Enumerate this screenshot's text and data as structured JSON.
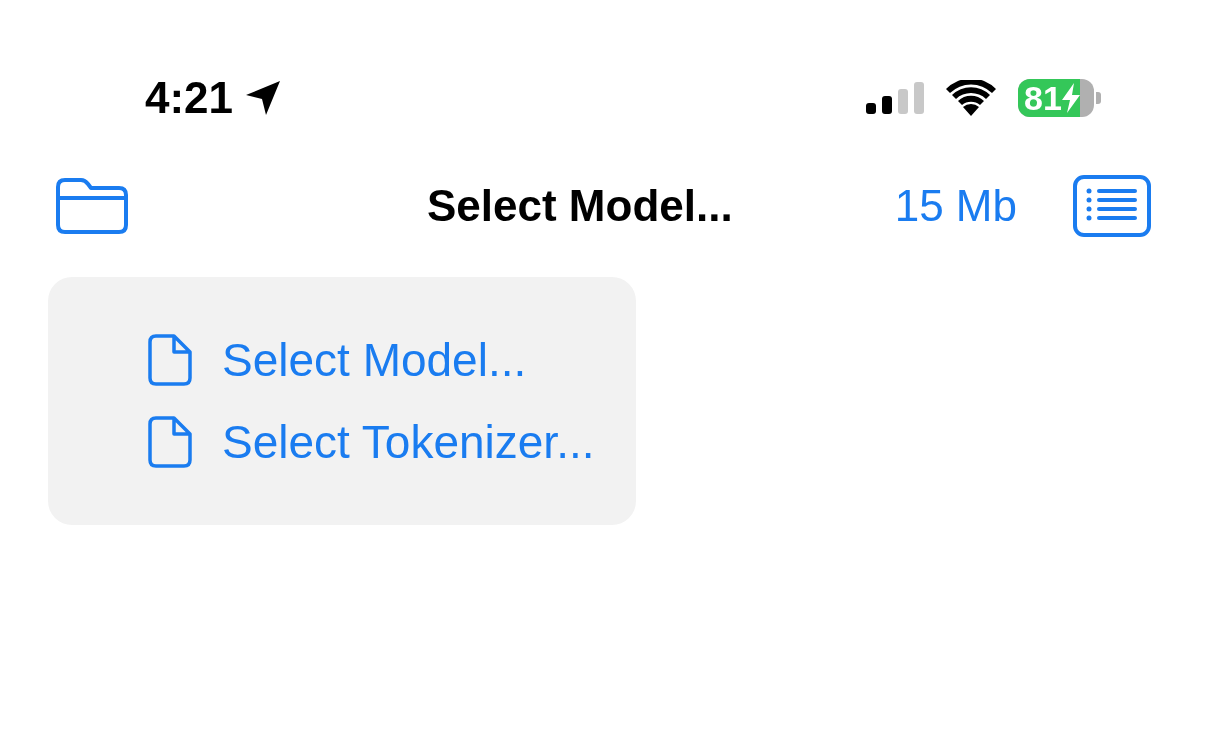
{
  "status_bar": {
    "time": "4:21",
    "battery_text": "81"
  },
  "nav_bar": {
    "title": "Select Model...",
    "size": "15 Mb"
  },
  "menu": {
    "items": [
      {
        "label": "Select Model..."
      },
      {
        "label": "Select Tokenizer..."
      }
    ]
  }
}
